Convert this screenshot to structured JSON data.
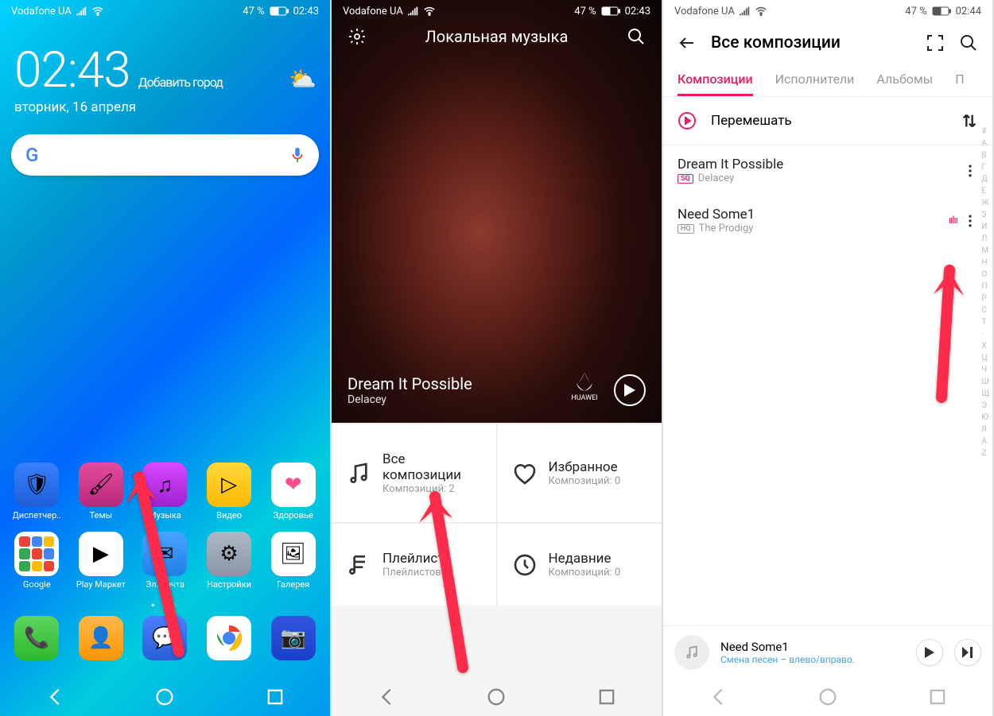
{
  "status": {
    "carrier": "Vodafone UA",
    "battery": "47 %",
    "time1": "02:43",
    "time3": "02:44"
  },
  "screen1": {
    "clock": "02:43",
    "add_city": "Добавить город",
    "date": "вторник, 16 апреля",
    "apps_row1": [
      {
        "label": "Диспетчер..",
        "class": "ic-shield",
        "glyph": "🛡"
      },
      {
        "label": "Темы",
        "class": "ic-themes",
        "glyph": "🖌"
      },
      {
        "label": "Музыка",
        "class": "ic-music",
        "glyph": "♫"
      },
      {
        "label": "Видео",
        "class": "ic-video",
        "glyph": "▷"
      },
      {
        "label": "Здоровье",
        "class": "ic-health",
        "glyph": "❤"
      }
    ],
    "apps_row2": [
      {
        "label": "Google",
        "class": "ic-folder",
        "glyph": ""
      },
      {
        "label": "Play Маркет",
        "class": "ic-play",
        "glyph": "▶"
      },
      {
        "label": "Эл. почта",
        "class": "ic-mail",
        "glyph": "✉"
      },
      {
        "label": "Настройки",
        "class": "ic-settings",
        "glyph": "⚙"
      },
      {
        "label": "Галерея",
        "class": "ic-gallery",
        "glyph": "🖼"
      }
    ],
    "dock": [
      {
        "label": "",
        "class": "ic-phone",
        "glyph": "📞"
      },
      {
        "label": "",
        "class": "ic-contacts",
        "glyph": "👤"
      },
      {
        "label": "",
        "class": "ic-sms",
        "glyph": "💬"
      },
      {
        "label": "",
        "class": "ic-chrome",
        "glyph": "◉"
      },
      {
        "label": "",
        "class": "ic-camera",
        "glyph": "📷"
      }
    ]
  },
  "screen2": {
    "title": "Локальная музыка",
    "now_title": "Dream It Possible",
    "now_artist": "Delacey",
    "brand": "HUAWEI",
    "tiles": [
      {
        "title": "Все композиции",
        "sub": "Композиций: 2"
      },
      {
        "title": "Избранное",
        "sub": "Композиций: 0"
      },
      {
        "title": "Плейлист",
        "sub": "Плейлистов: 0"
      },
      {
        "title": "Недавние",
        "sub": "Композиций: 0"
      }
    ]
  },
  "screen3": {
    "title": "Все композиции",
    "tabs": [
      "Композиции",
      "Исполнители",
      "Альбомы",
      "П"
    ],
    "shuffle": "Перемешать",
    "tracks": [
      {
        "title": "Dream It Possible",
        "artist": "Delacey",
        "badge": "SQ"
      },
      {
        "title": "Need Some1",
        "artist": "The Prodigy",
        "badge": "HQ",
        "playing": true
      }
    ],
    "alpha": [
      "#",
      "А",
      "В",
      "Г",
      "Д",
      "Е",
      "Ж",
      "З",
      "И",
      "Л",
      "М",
      "Н",
      "О",
      "П",
      "Р",
      "С",
      "Т",
      "·",
      "Х",
      "Ц",
      "Ч",
      "Ш",
      "Щ",
      "Э",
      "Ю",
      "Я",
      "A",
      "Z"
    ],
    "mini": {
      "title": "Need Some1",
      "sub": "Смена песен – влево/вправо."
    }
  }
}
